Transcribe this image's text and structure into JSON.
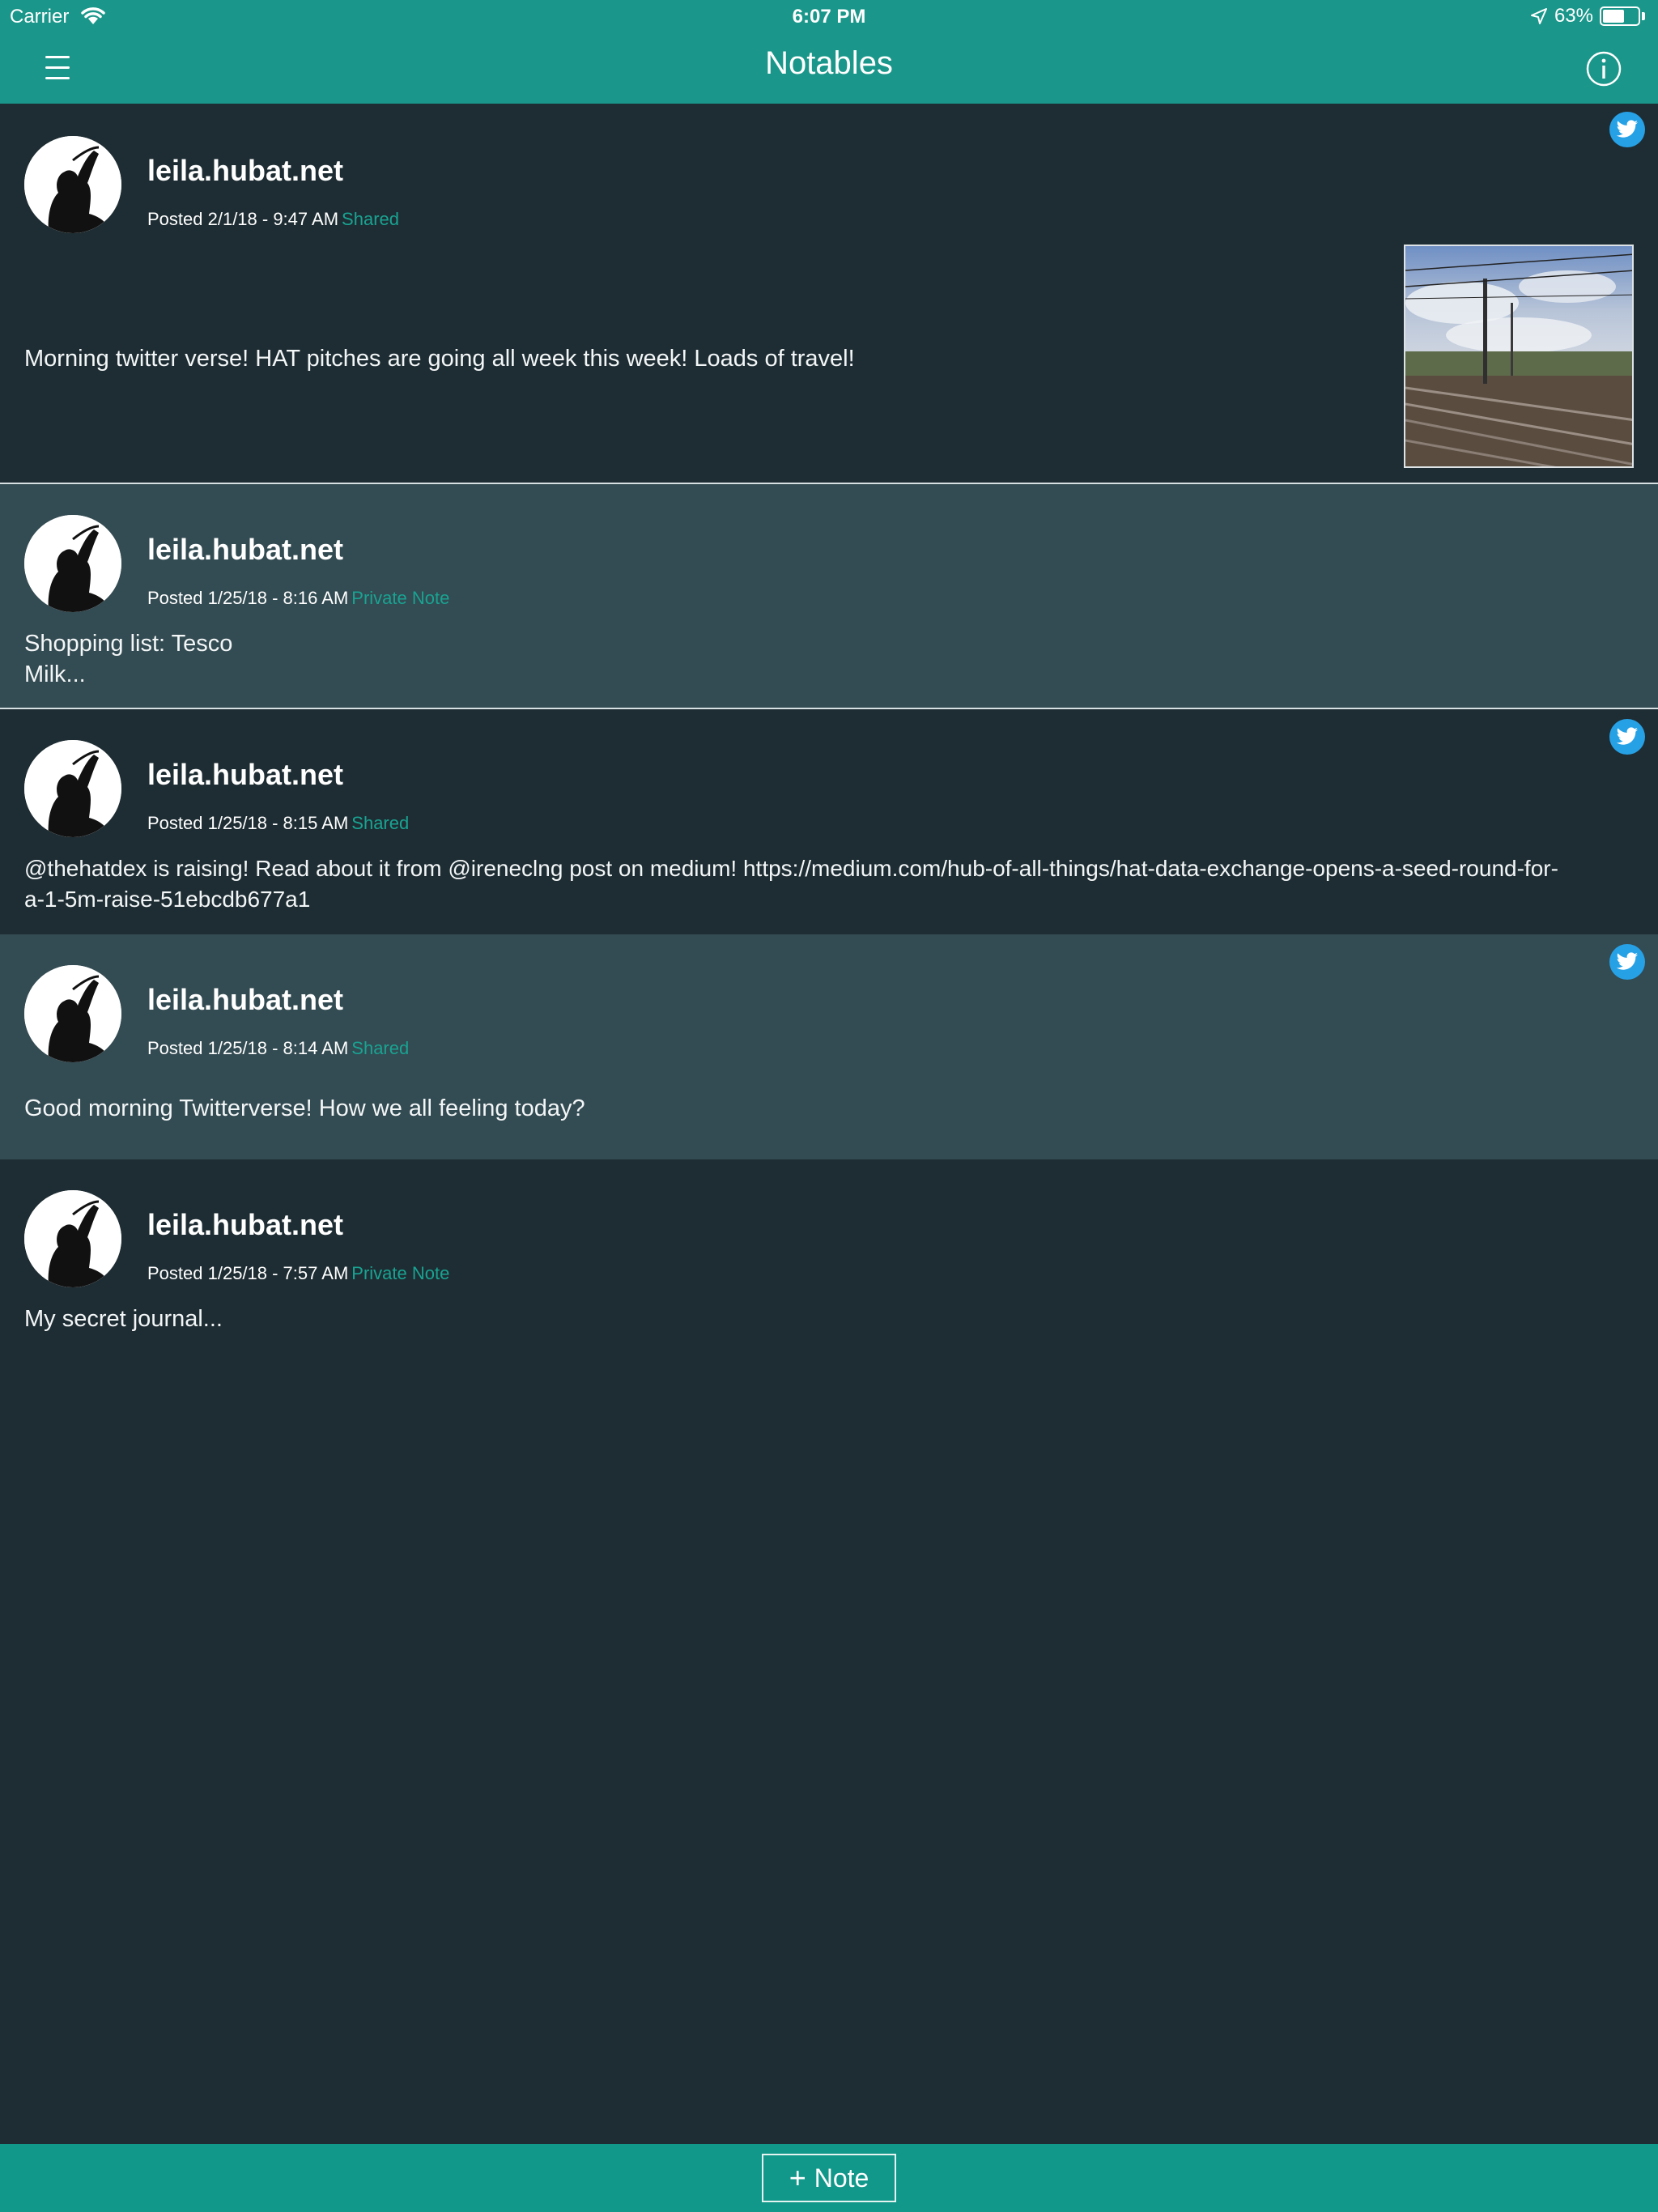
{
  "status_bar": {
    "carrier": "Carrier",
    "time": "6:07 PM",
    "battery_text": "63%",
    "battery_level": 0.63
  },
  "nav": {
    "title": "Notables",
    "menu_icon": "hamburger-icon",
    "info_icon": "info-icon"
  },
  "notes": [
    {
      "author": "leila.hubat.net",
      "posted": "Posted 2/1/18 - 9:47 AM",
      "status": "Shared",
      "text": "Morning twitter verse! HAT pitches are going all week this week! Loads of travel!",
      "twitter": true,
      "has_image": true
    },
    {
      "author": "leila.hubat.net",
      "posted": "Posted 1/25/18 - 8:16 AM",
      "status": "Private Note",
      "text_lines": [
        "Shopping list: Tesco",
        "Milk..."
      ],
      "twitter": false
    },
    {
      "author": "leila.hubat.net",
      "posted": "Posted 1/25/18 - 8:15 AM",
      "status": "Shared",
      "text_lines": [
        "@thehatdex is raising! Read about it from @ireneclng post on medium! https://medium.com/hub-of-all-things/hat-data-exchange-opens-a-seed-round-for-",
        "a-1-5m-raise-51ebcdb677a1"
      ],
      "twitter": true
    },
    {
      "author": "leila.hubat.net",
      "posted": "Posted 1/25/18 - 8:14 AM",
      "status": "Shared",
      "text": "Good morning Twitterverse! How we all feeling today?",
      "twitter": true
    },
    {
      "author": "leila.hubat.net",
      "posted": "Posted 1/25/18 - 7:57 AM",
      "status": "Private Note",
      "text": "My secret journal...",
      "twitter": false
    }
  ],
  "bottom_bar": {
    "add_label": "Note",
    "plus_icon": "plus-icon"
  },
  "colors": {
    "header": "#1a978a",
    "bg_dark": "#1e2d33",
    "bg_light": "#334b52",
    "accent": "#19a392",
    "twitter": "#27a1e6"
  }
}
